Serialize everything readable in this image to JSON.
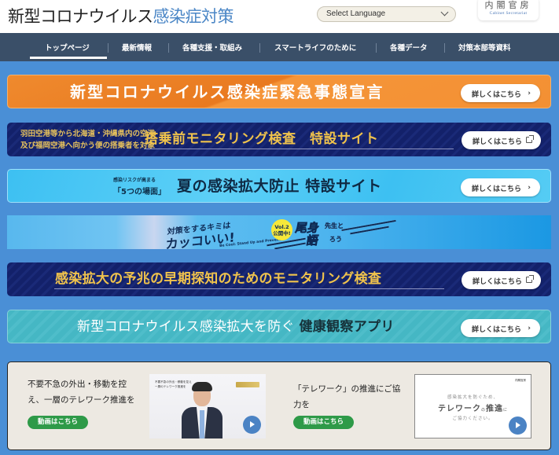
{
  "header": {
    "title_main": "新型コロナウイルス",
    "title_accent": "感染症対策",
    "language_select": "Select Language",
    "logo_jp": "内閣官房",
    "logo_en": "Cabinet Secretariat"
  },
  "nav": {
    "items": [
      {
        "label": "トップページ",
        "active": true
      },
      {
        "label": "最新情報"
      },
      {
        "label": "各種支援・取組み"
      },
      {
        "label": "スマートライフのために"
      },
      {
        "label": "各種データ"
      },
      {
        "label": "対策本部等資料"
      }
    ]
  },
  "colors": {
    "page_bg": "#4a8fd6",
    "nav_bg": "#3a4f68",
    "accent_title": "#4a86c6",
    "banner_orange": "#ef8a2e",
    "banner_navy": "#13216a",
    "banner_gold_text": "#f0c34c",
    "banner_sky": "#3dc0f2",
    "banner_teal": "#45b7c4",
    "video_button": "#2e9a48",
    "play_button": "#4b83c4"
  },
  "banners": {
    "emergency": {
      "title": "新型コロナウイルス感染症緊急事態宣言",
      "button": "詳しくはこちら",
      "button_icon": "chevron-right"
    },
    "airport_monitoring": {
      "subtitle_line1": "羽田空港等から北海道・沖縄県内の空港",
      "subtitle_line2": "及び福岡空港へ向かう便の搭乗者を対象",
      "title": "搭乗前モニタリング検査　特設サイト",
      "button": "詳しくはこちら",
      "button_icon": "external-link"
    },
    "summer": {
      "small_line1": "感染リスクが高まる",
      "small_line2": "「5つの場面」",
      "title": "夏の感染拡大防止 特設サイト",
      "button": "詳しくはこちら",
      "button_icon": "chevron-right"
    },
    "omi": {
      "line1": "対策をするキミは",
      "line2": "カッコいい!",
      "line3": "Be Cool: Stand Up and Prevent",
      "vol": "Vol.2",
      "vol_sub": "公開中!",
      "name": "尾身",
      "sensei": "先生と",
      "talk": "語",
      "rou": "ろう"
    },
    "early_detection": {
      "title": "感染拡大の予兆の早期探知のためのモニタリング検査",
      "button": "詳しくはこちら",
      "button_icon": "external-link"
    },
    "health_app": {
      "title_light": "新型コロナウイルス感染拡大を防ぐ",
      "title_dark": "健康観察アプリ",
      "button": "詳しくはこちら",
      "button_icon": "chevron-right"
    }
  },
  "videos": [
    {
      "text_line1": "不要不急の外出・移動を控",
      "text_line2": "え、一層のテレワーク推進を",
      "button": "動画はこちら",
      "thumb_caption1": "不要不急の外出・移動を控え",
      "thumb_caption2": "一層のテレワーク推進を"
    },
    {
      "text_line1": "「テレワーク」の推進にご協",
      "text_line2": "力を",
      "button": "動画はこちら",
      "thumb_line1": "感染拡大を防ぐため、",
      "thumb_line2a": "テレワーク",
      "thumb_line2b": "の",
      "thumb_line2c": "推進",
      "thumb_line2d": "に",
      "thumb_line3": "ご協力ください。",
      "thumb_corner": "内閣官房"
    }
  ]
}
